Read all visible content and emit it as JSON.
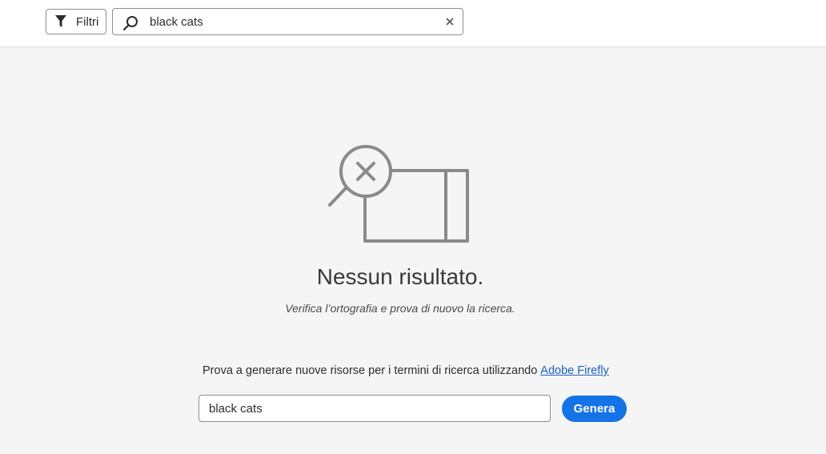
{
  "toolbar": {
    "filter_label": "Filtri",
    "search_value": "black cats"
  },
  "empty_state": {
    "title": "Nessun risultato.",
    "subtitle": "Verifica l’ortografia e prova di nuovo la ricerca."
  },
  "firefly": {
    "prompt_text": "Prova a generare nuove risorse per i termini di ricerca utilizzando",
    "link_text": "Adobe Firefly",
    "input_value": "black cats",
    "button_label": "Genera"
  },
  "icons": {
    "filter": "filter-icon",
    "search": "search-icon",
    "clear": "close-icon",
    "illustration": "no-results-illustration"
  },
  "colors": {
    "accent": "#1473e6",
    "link": "#1c5fc6",
    "background": "#f5f5f5",
    "illustration_stroke": "#8a8a8a"
  }
}
